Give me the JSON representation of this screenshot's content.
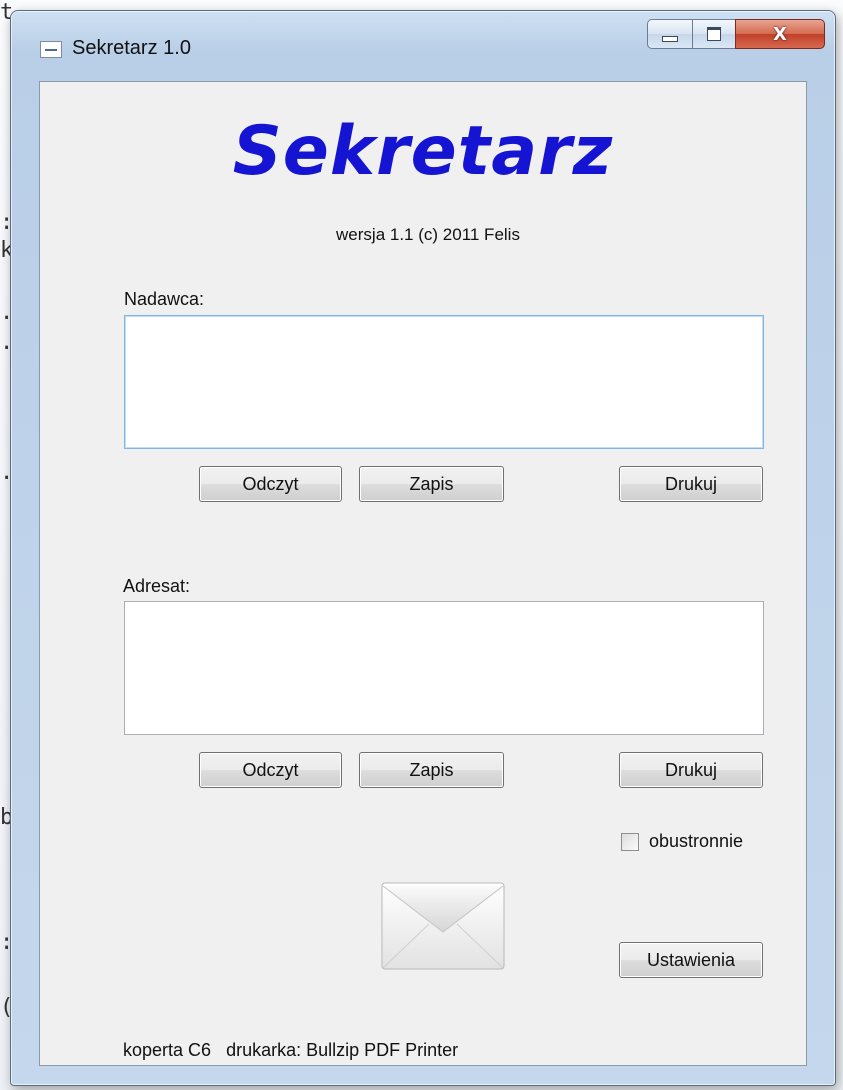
{
  "window": {
    "title": "Sekretarz 1.0",
    "controls": {
      "minimize": "minimize",
      "maximize": "maximize",
      "close": "X"
    }
  },
  "header": {
    "app_title": "Sekretarz",
    "version_text": "wersja 1.1   (c) 2011 Felis"
  },
  "sender": {
    "label": "Nadawca:",
    "value": "",
    "buttons": {
      "read": "Odczyt",
      "save": "Zapis",
      "print": "Drukuj"
    }
  },
  "recipient": {
    "label": "Adresat:",
    "value": "",
    "buttons": {
      "read": "Odczyt",
      "save": "Zapis",
      "print": "Drukuj"
    }
  },
  "options": {
    "duplex_label": "obustronnie",
    "duplex_checked": false,
    "settings_button": "Ustawienia"
  },
  "status_bar": {
    "envelope": "koperta C6",
    "printer": "drukarka: Bullzip PDF Printer"
  },
  "colors": {
    "title_blue": "#1414d2",
    "close_red": "#c0402a"
  }
}
